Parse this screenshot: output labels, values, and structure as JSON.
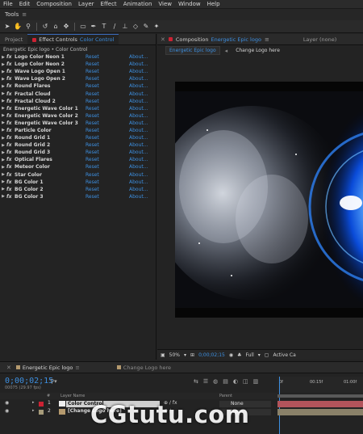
{
  "menu": [
    "File",
    "Edit",
    "Composition",
    "Layer",
    "Effect",
    "Animation",
    "View",
    "Window",
    "Help"
  ],
  "tools_label": "Tools",
  "left_panel": {
    "tabs": [
      {
        "label": "Project",
        "active": false
      },
      {
        "label": "Effect Controls",
        "suffix": "Color Control",
        "active": true
      }
    ],
    "path": "Energetic Epic logo • Color Control",
    "effects": [
      {
        "name": "Logo Color Neon 1",
        "reset": "Reset",
        "about": "About..."
      },
      {
        "name": "Logo Color Neon 2",
        "reset": "Reset",
        "about": "About..."
      },
      {
        "name": "Wave Logo Open 1",
        "reset": "Reset",
        "about": "About..."
      },
      {
        "name": "Wave Logo Open 2",
        "reset": "Reset",
        "about": "About..."
      },
      {
        "name": "Round Flares",
        "reset": "Reset",
        "about": "About..."
      },
      {
        "name": "Fractal Cloud",
        "reset": "Reset",
        "about": "About..."
      },
      {
        "name": "Fractal Cloud 2",
        "reset": "Reset",
        "about": "About..."
      },
      {
        "name": "Energetic Wave Color 1",
        "reset": "Reset",
        "about": "About..."
      },
      {
        "name": "Energetic Wave Color 2",
        "reset": "Reset",
        "about": "About..."
      },
      {
        "name": "Energetic Wave Color 3",
        "reset": "Reset",
        "about": "About..."
      },
      {
        "name": "Particle Color",
        "reset": "Reset",
        "about": "About..."
      },
      {
        "name": "Round Grid 1",
        "reset": "Reset",
        "about": "About..."
      },
      {
        "name": "Round Grid 2",
        "reset": "Reset",
        "about": "About..."
      },
      {
        "name": "Round Grid 3",
        "reset": "Reset",
        "about": "About..."
      },
      {
        "name": "Optical Flares",
        "reset": "Reset",
        "about": "About..."
      },
      {
        "name": "Meteor Color",
        "reset": "Reset",
        "about": "About..."
      },
      {
        "name": "Star Color",
        "reset": "Reset",
        "about": "About..."
      },
      {
        "name": "BG Color 1",
        "reset": "Reset",
        "about": "About..."
      },
      {
        "name": "BG Color 2",
        "reset": "Reset",
        "about": "About..."
      },
      {
        "name": "BG Color 3",
        "reset": "Reset",
        "about": "About..."
      }
    ]
  },
  "comp_panel": {
    "tab_prefix": "Composition",
    "tab_name": "Energetic Epic logo",
    "layer_tab": "Layer (none)",
    "subtabs": [
      "Energetic Epic logo",
      "Change Logo here"
    ],
    "footer": {
      "zoom": "50%",
      "timecode": "0;00;02;15",
      "resolution": "Full",
      "camera": "Active Ca"
    }
  },
  "timeline": {
    "tabs": [
      "Energetic Epic logo",
      "Change Logo here"
    ],
    "time": "0;00;02;15",
    "fps": "00075 (29.97 fps)",
    "ruler": [
      "0f",
      "00:15f",
      "01:00f"
    ],
    "columns": {
      "num": "#",
      "name": "Layer Name",
      "parent": "Parent"
    },
    "layers": [
      {
        "num": "1",
        "name": "Color Control",
        "parent": "None"
      },
      {
        "num": "2",
        "name": "[Change Logo here]",
        "parent": "None"
      }
    ]
  },
  "watermark": "CGtutu.com",
  "colors": {
    "accent": "#3d8fe0",
    "label_red": "#c23",
    "panel": "#232323"
  }
}
